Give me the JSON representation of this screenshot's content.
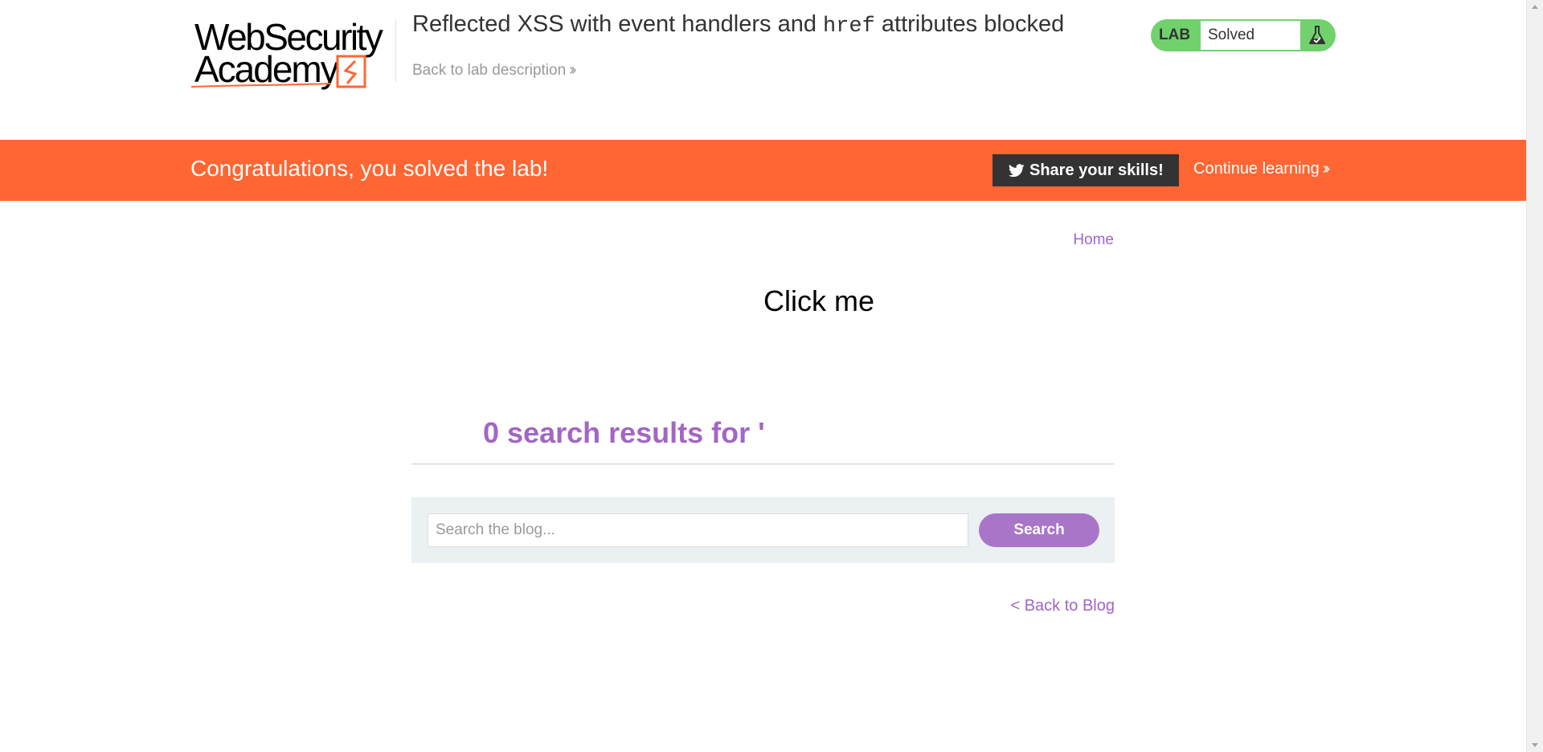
{
  "header": {
    "logo": {
      "line1": "WebSecurity",
      "line2": "Academy"
    },
    "lab_title_pre": "Reflected XSS with event handlers and ",
    "lab_title_code": "href",
    "lab_title_post": " attributes blocked",
    "back_to_description": "Back to lab description",
    "status": {
      "label": "LAB",
      "value": "Solved",
      "icon": "flask-icon"
    }
  },
  "banner": {
    "message": "Congratulations, you solved the lab!",
    "share_label": "Share your skills!",
    "share_icon": "twitter-icon",
    "continue_label": "Continue learning"
  },
  "nav": {
    "home": "Home"
  },
  "main": {
    "link_text": "Click me",
    "results_heading": "0 search results for '",
    "search": {
      "placeholder": "Search the blog...",
      "value": "",
      "button_label": "Search"
    },
    "back_to_blog": "< Back to Blog"
  },
  "colors": {
    "accent": "#ff6633",
    "link": "#a266c4",
    "button": "#a975c8",
    "status": "#70d16d",
    "search_bg": "#ebf0f2"
  }
}
